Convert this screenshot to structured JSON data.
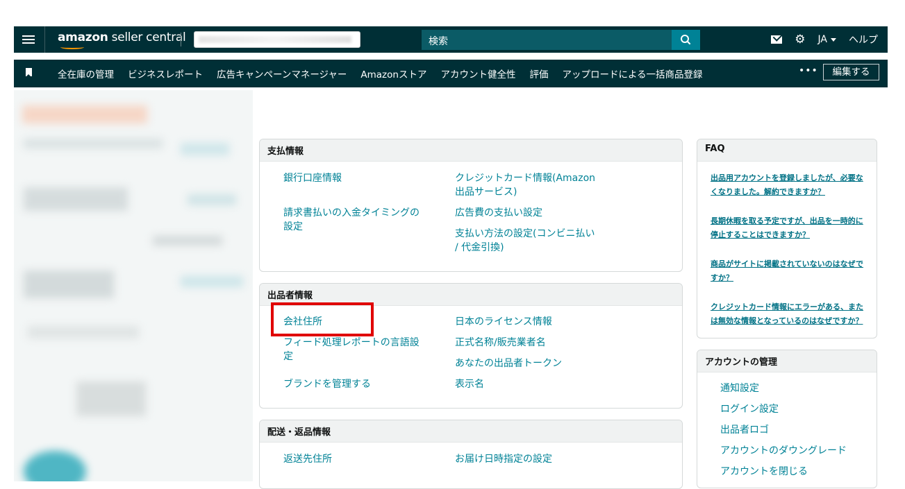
{
  "header": {
    "logo_main": "amazon",
    "logo_sub": " seller central",
    "search_placeholder": "検索",
    "lang": "JA",
    "help": "ヘルプ"
  },
  "nav": {
    "items": [
      "全在庫の管理",
      "ビジネスレポート",
      "広告キャンペーンマネージャー",
      "Amazonストア",
      "アカウント健全性",
      "評価",
      "アップロードによる一括商品登録"
    ],
    "more": "•••",
    "edit": "編集する"
  },
  "payment": {
    "title": "支払情報",
    "links": [
      "銀行口座情報",
      "クレジットカード情報(Amazon\n出品サービス)",
      "請求書払いの入金タイミングの\n設定",
      "広告費の支払い設定",
      "支払い方法の設定(コンビニ払い\n/ 代金引換)"
    ]
  },
  "seller": {
    "title": "出品者情報",
    "links": [
      "会社住所",
      "日本のライセンス情報",
      "フィード処理レポートの言語設\n定",
      "正式名称/販売業者名",
      "あなたの出品者トークン",
      "ブランドを管理する",
      "表示名"
    ]
  },
  "shipping": {
    "title": "配送・返品情報",
    "links": [
      "返送先住所",
      "お届け日時指定の設定"
    ]
  },
  "faq": {
    "title": "FAQ",
    "links": [
      "出品用アカウントを登録しましたが、必要なくなりました。解約できますか？",
      "長期休暇を取る予定ですが、出品を一時的に停止することはできますか？",
      "商品がサイトに掲載されていないのはなぜですか？",
      "クレジットカード情報にエラーがある、または無効な情報となっているのはなぜですか？"
    ]
  },
  "account": {
    "title": "アカウントの管理",
    "links": [
      "通知設定",
      "ログイン設定",
      "出品者ロゴ",
      "アカウントのダウングレード",
      "アカウントを閉じる"
    ]
  },
  "colors": {
    "header_bg": "#002f36",
    "search_bg": "#0b5b66",
    "search_btn": "#008296",
    "link": "#008296",
    "highlight": "#e00000"
  }
}
